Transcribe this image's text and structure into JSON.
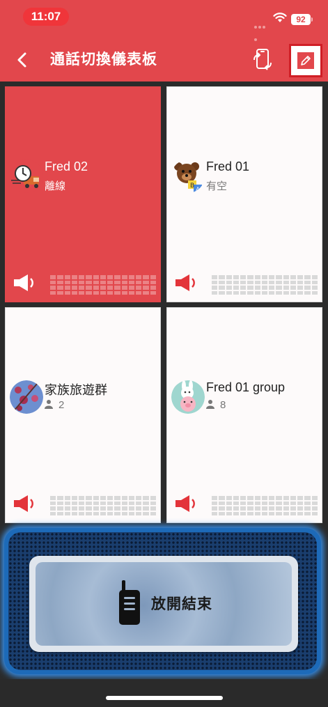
{
  "status_bar": {
    "time": "11:07",
    "battery": "92"
  },
  "header": {
    "title": "通話切換儀表板",
    "back_icon": "chevron-left-icon",
    "switch_icon": "phone-switch-icon",
    "edit_icon": "pencil-icon"
  },
  "colors": {
    "brand": "#e2474c",
    "speaker": "#e3343a",
    "ptt_glow": "#3b9cff"
  },
  "cards": [
    {
      "name": "Fred 02",
      "sub": "離線",
      "active": true,
      "avatar": "delivery-truck-clock-avatar",
      "has_count": false
    },
    {
      "name": "Fred 01",
      "sub": "有空",
      "active": false,
      "avatar": "teddy-bear-blocks-avatar",
      "has_count": false
    },
    {
      "name": "家族旅遊群",
      "sub": "2",
      "active": false,
      "avatar": "blossom-photo-avatar",
      "has_count": true
    },
    {
      "name": "Fred 01 group",
      "sub": "8",
      "active": false,
      "avatar": "bunny-pig-avatar",
      "has_count": true
    }
  ],
  "ptt": {
    "label": "放開結束",
    "icon": "walkie-talkie-icon"
  }
}
